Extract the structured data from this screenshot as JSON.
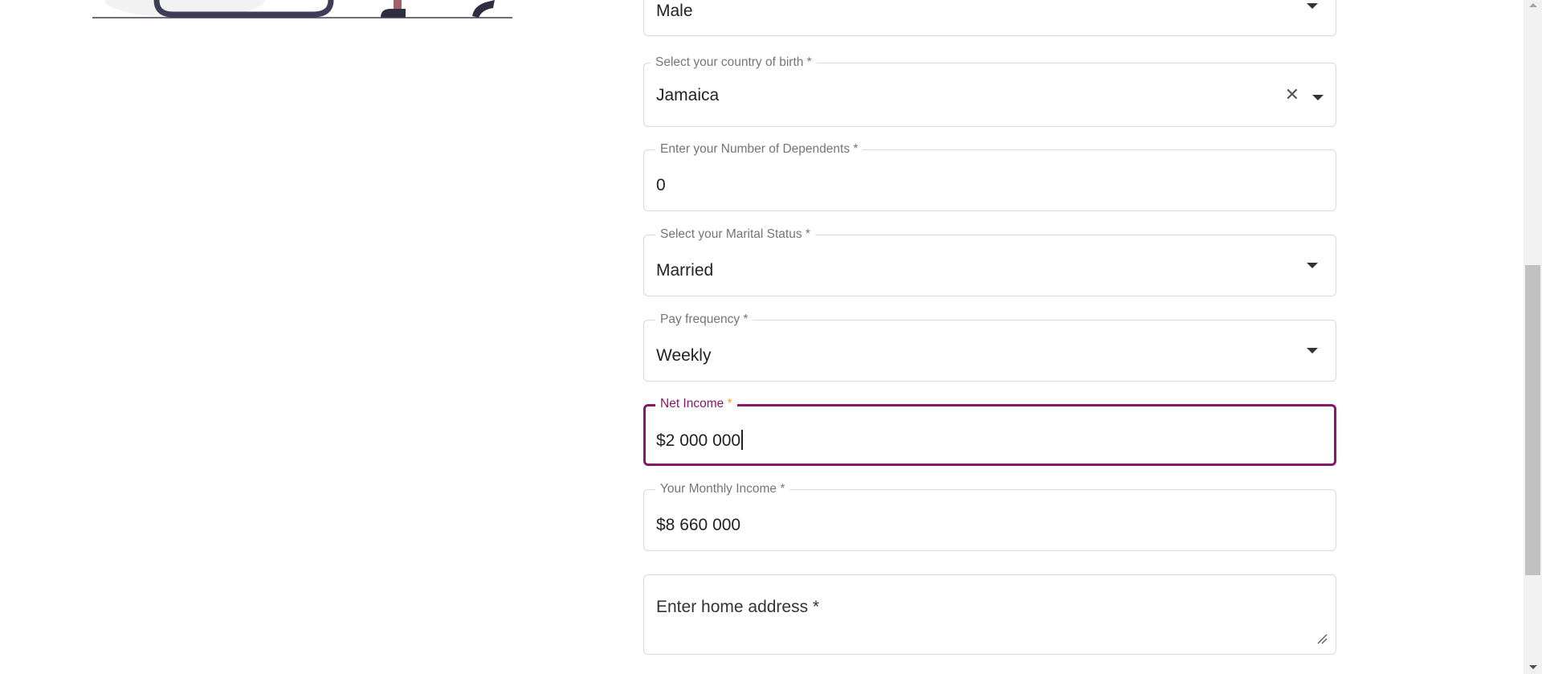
{
  "form": {
    "gender": {
      "value": "Male"
    },
    "country_of_birth": {
      "label": "Select your country of birth *",
      "value": "Jamaica",
      "clear_icon": "close-icon"
    },
    "dependents": {
      "label": "Enter your Number of Dependents *",
      "value": "0"
    },
    "marital_status": {
      "label": "Select your Marital Status *",
      "value": "Married"
    },
    "pay_frequency": {
      "label": "Pay frequency *",
      "value": "Weekly"
    },
    "net_income": {
      "label": "Net Income",
      "required_mark": "*",
      "value": "$2 000 000"
    },
    "monthly_income": {
      "label": "Your Monthly Income *",
      "value": "$8 660 000"
    },
    "home_address": {
      "placeholder": "Enter home address *"
    }
  },
  "colors": {
    "focus_border": "#86196a",
    "required_accent": "#f5a623",
    "border": "#d9d9d9",
    "text": "#222222"
  }
}
